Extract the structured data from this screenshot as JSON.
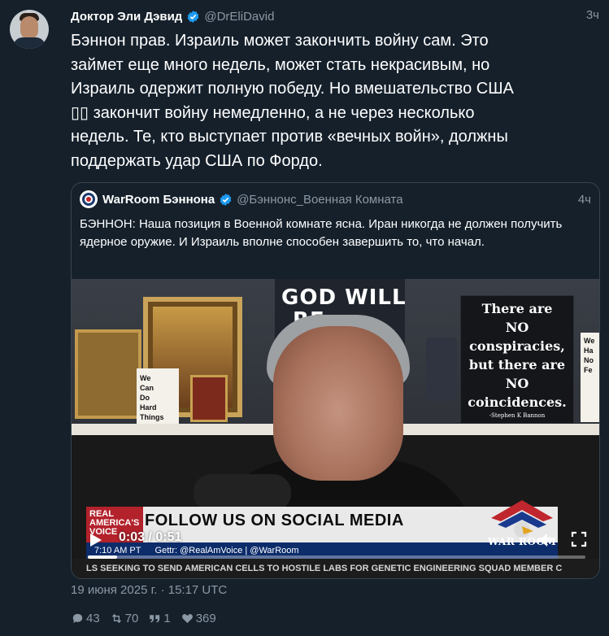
{
  "tweet": {
    "author_name": "Доктор Эли Дэвид",
    "author_handle": "@DrEliDavid",
    "time": "3ч",
    "text": "Бэннон прав. Израиль может закончить войну сам. Это\nзаймет еще много недель, может стать некрасивым, но\nИзраиль одержит полную победу. Но вмешательство США\n▯▯ закончит войну немедленно, а не через несколько\nнедель. Те, кто выступает против «вечных войн», должны\nподдержать удар США по Фордо.",
    "timestamp": "19 июня 2025 г. · 15:17 UTC"
  },
  "quote": {
    "author_name": "WarRoom Бэннона",
    "author_handle": "@Бэннонс_Военная Комната",
    "time": "4ч",
    "text": "БЭННОН: Наша позиция в Военной комнате ясна. Иран никогда не должен получить ядерное оружие. И Израиль вполне способен завершить то, что начал."
  },
  "video": {
    "sign_line1": "GOD WILL",
    "sign_line2": "RE",
    "card_text": "We\nCan\nDo\nHard\nThings",
    "poster_lines": [
      "There are",
      "NO",
      "conspiracies,",
      "but there are",
      "NO",
      "coincidences."
    ],
    "poster_signature": "-Stephen K Bannon",
    "poster_right": "We\nHa\nNo\nFe",
    "channel_logo": "REAL AMERICA'S VOICE",
    "lower_third_title": "FOLLOW US ON SOCIAL MEDIA",
    "lower_third_sub": "Gettr: @RealAmVoice | @WarRoom",
    "lower_third_clock": "7:10 AM PT",
    "ticker": "LS SEEKING TO SEND AMERICAN CELLS TO HOSTILE LABS FOR GENETIC ENGINEERING     SQUAD MEMBER C",
    "war_room_label": "WAR ROOM",
    "timecode": "0:03 / 0:51",
    "progress": 0.059
  },
  "actions": {
    "replies": "43",
    "retweets": "70",
    "quotes": "1",
    "likes": "369"
  },
  "colors": {
    "background": "#15202b",
    "secondary_text": "#8b98a5",
    "border": "#38444d",
    "verified_blue": "#1d9bf0",
    "verified_gold": "#e2b719"
  },
  "icons": [
    "verified-badge-icon",
    "play-icon",
    "volume-icon",
    "fullscreen-icon",
    "reply-icon",
    "retweet-icon",
    "quote-icon",
    "like-icon"
  ]
}
